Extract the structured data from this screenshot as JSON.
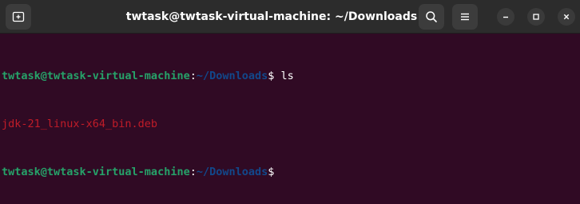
{
  "window": {
    "title": "twtask@twtask-virtual-machine: ~/Downloads"
  },
  "titlebar": {
    "new_tab_icon": "new-tab-icon",
    "search_icon": "search-icon",
    "menu_icon": "hamburger-menu-icon",
    "minimize_icon": "minimize-icon",
    "maximize_icon": "maximize-icon",
    "close_icon": "close-icon"
  },
  "terminal": {
    "lines": [
      {
        "user": "twtask@twtask-virtual-machine",
        "colon": ":",
        "path": "~/Downloads",
        "dollar": "$",
        "command": " ls"
      },
      {
        "output": "jdk-21_linux-x64_bin.deb"
      },
      {
        "user": "twtask@twtask-virtual-machine",
        "colon": ":",
        "path": "~/Downloads",
        "dollar": "$",
        "command": ""
      }
    ]
  },
  "colors": {
    "background": "#300a24",
    "titlebar": "#2c2c2c",
    "prompt_user": "#26a269",
    "prompt_path": "#12488b",
    "file_output": "#c01c28",
    "text": "#ffffff"
  }
}
